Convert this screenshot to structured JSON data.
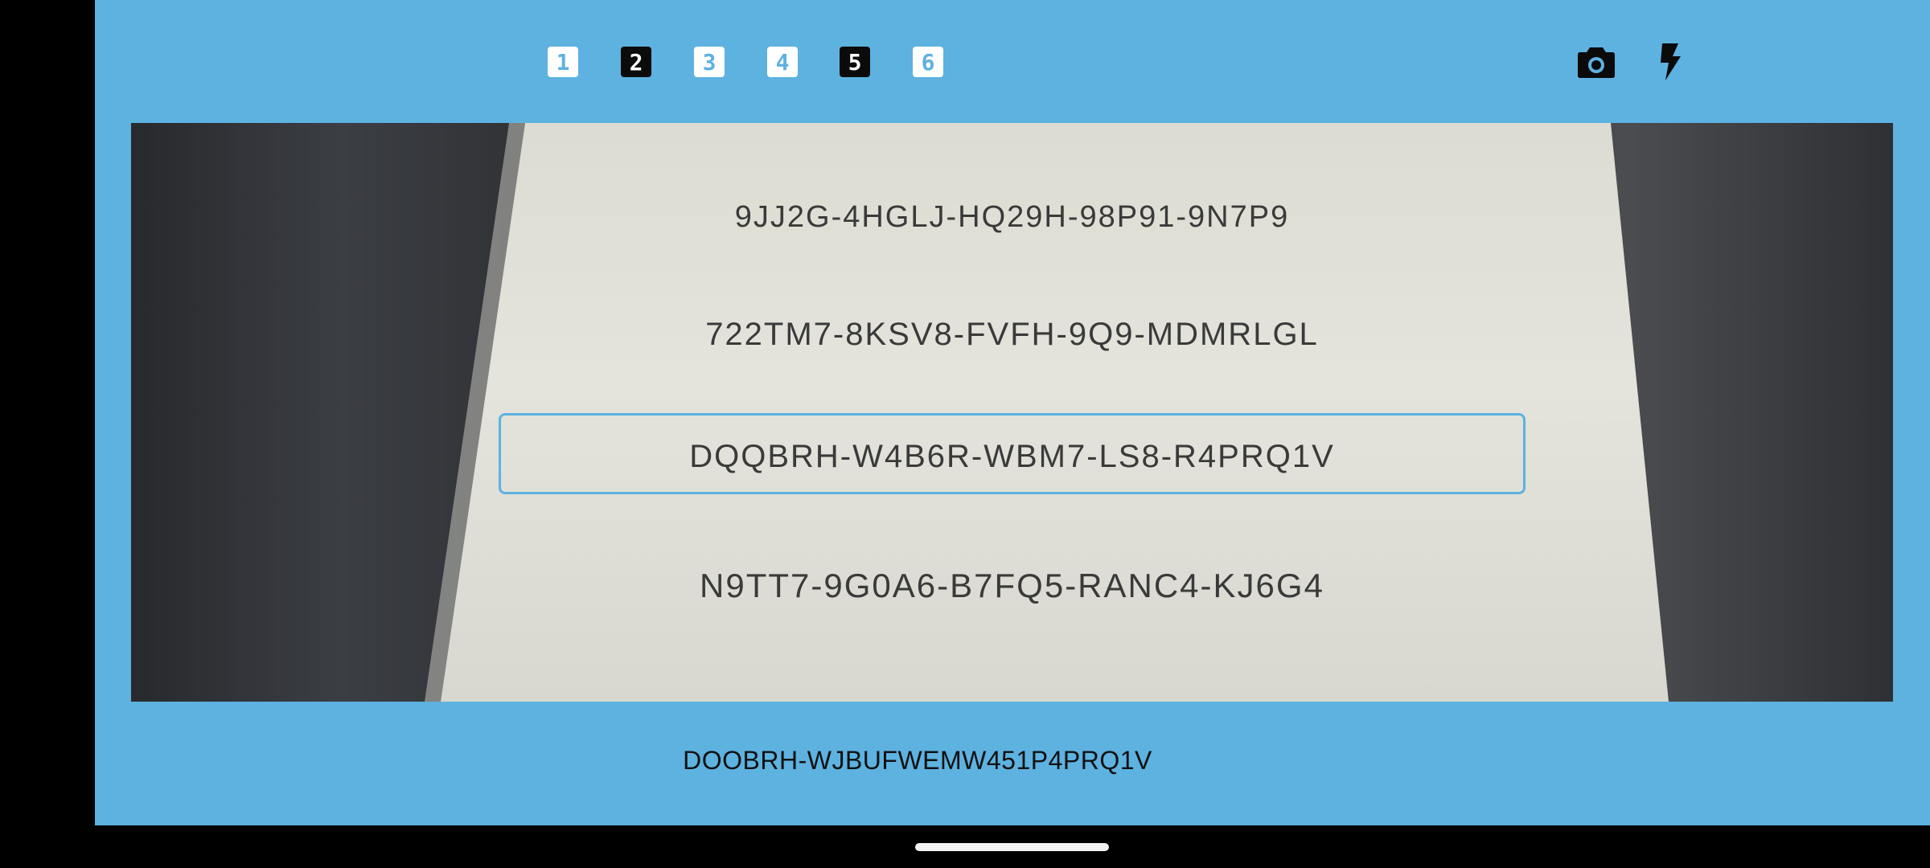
{
  "modes": [
    {
      "label": "1",
      "style": "light"
    },
    {
      "label": "2",
      "style": "dark"
    },
    {
      "label": "3",
      "style": "light"
    },
    {
      "label": "4",
      "style": "light"
    },
    {
      "label": "5",
      "style": "dark"
    },
    {
      "label": "6",
      "style": "light"
    }
  ],
  "actions": {
    "camera_icon": "camera-icon",
    "flash_icon": "flash-icon"
  },
  "preview": {
    "lines": [
      "9JJ2G-4HGLJ-HQ29H-98P91-9N7P9",
      "722TM7-8KSV8-FVFH-9Q9-MDMRLGL",
      "DQQBRH-W4B6R-WBM7-LS8-R4PRQ1V",
      "N9TT7-9G0A6-B7FQ5-RANC4-KJ6G4"
    ]
  },
  "result": {
    "text": "DOOBRH-WJBUFWEMW451P4PRQ1V"
  },
  "colors": {
    "app_background": "#5DB2E0",
    "selection_box": "#5DB2E0"
  }
}
